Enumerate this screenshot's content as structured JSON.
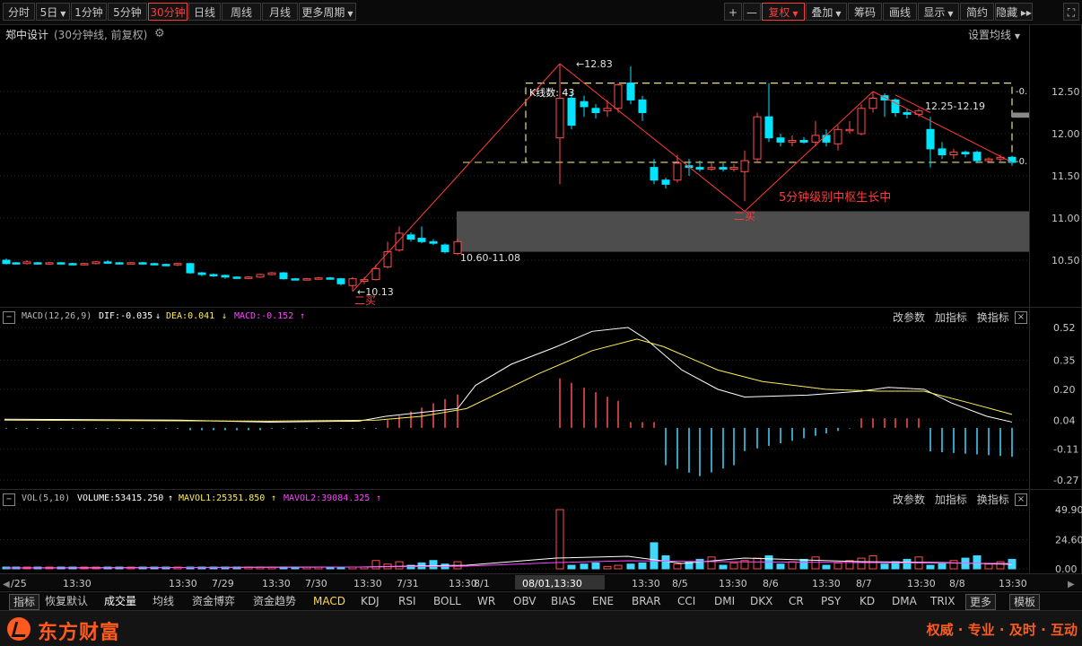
{
  "toolbar": {
    "periods": [
      {
        "label": "分时",
        "caret": false,
        "active": false
      },
      {
        "label": "5日",
        "caret": true,
        "active": false
      },
      {
        "label": "1分钟",
        "caret": false,
        "active": false
      },
      {
        "label": "5分钟",
        "caret": false,
        "active": false
      },
      {
        "label": "30分钟",
        "caret": false,
        "active": true
      },
      {
        "label": "日线",
        "caret": false,
        "active": false
      },
      {
        "label": "周线",
        "caret": false,
        "active": false
      },
      {
        "label": "月线",
        "caret": false,
        "active": false
      },
      {
        "label": "更多周期",
        "caret": true,
        "active": false
      }
    ],
    "right_buttons": [
      {
        "label": "+",
        "caret": false,
        "active": false
      },
      {
        "label": "—",
        "caret": false,
        "active": false
      },
      {
        "label": "复权",
        "caret": true,
        "active": true
      },
      {
        "label": "叠加",
        "caret": true,
        "active": false
      },
      {
        "label": "筹码",
        "caret": false,
        "active": false
      },
      {
        "label": "画线",
        "caret": false,
        "active": false
      },
      {
        "label": "显示",
        "caret": true,
        "active": false
      },
      {
        "label": "简约",
        "caret": false,
        "active": false
      },
      {
        "label": "隐藏 ▸▸",
        "caret": false,
        "active": false
      }
    ],
    "expand_icon": "fullscreen-icon"
  },
  "title": {
    "stock_name": "郑中设计",
    "subtitle": "(30分钟线, 前复权)",
    "settings_link": "设置均线",
    "accent": "#ff3b3b"
  },
  "chart_data": [
    {
      "type": "candlestick",
      "ylim": [
        10.1,
        12.95
      ],
      "y_ticks": [
        "12.50",
        "12.00",
        "11.50",
        "11.00",
        "10.50"
      ],
      "x_labels": [
        "/25",
        "13:30",
        "13:30",
        "7/29",
        "13:30",
        "7/30",
        "13:30",
        "7/31",
        "13:30",
        "8/1",
        "13:30",
        "08/01,13:30",
        "13:30",
        "8/5",
        "13:30",
        "8/6",
        "13:30",
        "8/7",
        "13:30",
        "8/8",
        "13:30"
      ],
      "annotations": [
        {
          "text": "12.83",
          "type": "high_marker"
        },
        {
          "text": "10.13",
          "type": "low_marker"
        },
        {
          "text": "K线数: 43"
        },
        {
          "text": "10.60-11.08"
        },
        {
          "text": "12.25-12.19"
        },
        {
          "text": "5分钟级别中枢生长中"
        },
        {
          "text": "二买"
        },
        {
          "text": "二买"
        },
        {
          "text": "-0."
        },
        {
          "text": "-0."
        }
      ],
      "candles_up_color": "#ff4d4d",
      "candles_down_color": "#00e5ff",
      "zone_gray": [
        10.6,
        11.08
      ],
      "zone_box": [
        11.66,
        12.6
      ]
    },
    {
      "type": "macd",
      "name": "MACD(12,26,9)",
      "dif_label": "DIF:-0.035",
      "dea_label": "DEA:0.041",
      "macd_label": "MACD:-0.152",
      "ylim": [
        -0.3,
        0.55
      ],
      "y_ticks": [
        "0.52",
        "0.35",
        "0.20",
        "0.04",
        "-0.11",
        "-0.27"
      ]
    },
    {
      "type": "volume",
      "name": "VOL(5,10)",
      "volume_label": "VOLUME:53415.250",
      "mavol1_label": "MAVOL1:25351.850",
      "mavol2_label": "MAVOL2:39084.325",
      "y_ticks": [
        "49.90",
        "24.60",
        "0.00"
      ]
    }
  ],
  "panel_buttons": {
    "params": "改参数",
    "add": "加指标",
    "switch": "换指标",
    "close": "×"
  },
  "indicator_tabs": [
    "指标",
    "恢复默认",
    "成交量",
    "均线",
    "资金博弈",
    "资金趋势",
    "MACD",
    "KDJ",
    "RSI",
    "BOLL",
    "WR",
    "OBV",
    "BIAS",
    "ENE",
    "BRAR",
    "CCI",
    "DMI",
    "DKX",
    "CR",
    "PSY",
    "KD",
    "DMA",
    "TRIX",
    "更多",
    "模板"
  ],
  "brand": {
    "name": "东方财富",
    "slogan": "权威 · 专业 · 及时 · 互动",
    "color": "#ff5a1f"
  }
}
